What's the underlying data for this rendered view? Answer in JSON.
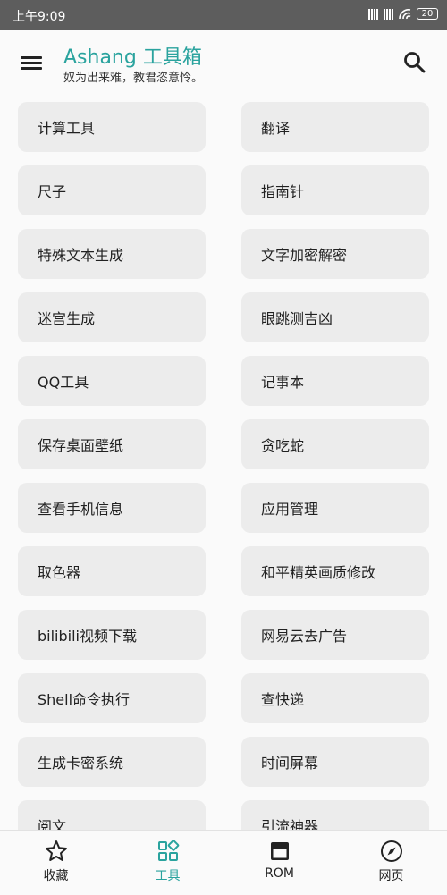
{
  "status_bar": {
    "time": "上午9:09",
    "battery": "20"
  },
  "app_bar": {
    "title": "Ashang 工具箱",
    "subtitle": "奴为出来难，教君恣意怜。"
  },
  "tools": [
    "计算工具",
    "翻译",
    "尺子",
    "指南针",
    "特殊文本生成",
    "文字加密解密",
    "迷宫生成",
    "眼跳测吉凶",
    "QQ工具",
    "记事本",
    "保存桌面壁纸",
    "贪吃蛇",
    "查看手机信息",
    "应用管理",
    "取色器",
    "和平精英画质修改",
    "bilibili视频下载",
    "网易云去广告",
    "Shell命令执行",
    "查快递",
    "生成卡密系统",
    "时间屏幕",
    "阅文",
    "引流神器"
  ],
  "bottom_nav": {
    "items": [
      {
        "label": "收藏",
        "icon": "star-icon"
      },
      {
        "label": "工具",
        "icon": "grid-icon",
        "active": true
      },
      {
        "label": "ROM",
        "icon": "window-icon"
      },
      {
        "label": "网页",
        "icon": "compass-icon"
      }
    ]
  },
  "colors": {
    "accent": "#2aa39e",
    "status_bar": "#5d5d5d",
    "tile_bg": "#ececec"
  }
}
